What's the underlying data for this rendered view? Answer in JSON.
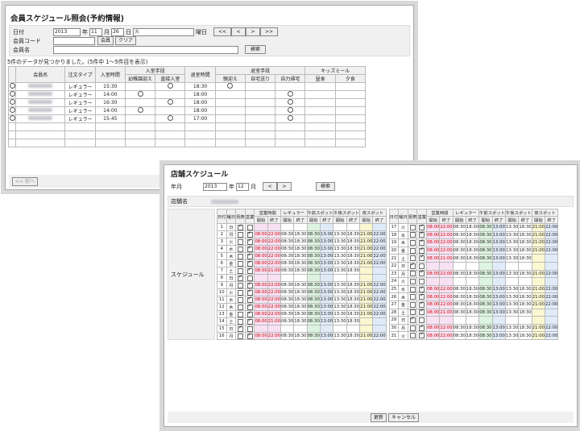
{
  "win1": {
    "title": "会員スケジュール照会(予約情報)",
    "labels": {
      "date": "日付",
      "member_code": "会員コード",
      "member_name": "会員名"
    },
    "date": {
      "year": "2013",
      "year_unit": "年",
      "month": "11",
      "month_unit": "月",
      "day": "26",
      "day_unit": "日",
      "weekday": "火",
      "weekday_label": "曜日"
    },
    "nav": [
      "<<",
      "<",
      ">",
      ">>"
    ],
    "member_button": "会員",
    "clear_button": "クリア",
    "search_button": "検索",
    "result_message": "5件のデータが見つかりました。(5件中 1〜5件目を表示)",
    "headers": {
      "name": "会員名",
      "type": "注文タイプ",
      "entry_time": "入室時間",
      "entry_method": "入室手段",
      "pickup": "幼稚園迎え",
      "direct": "直接入室",
      "exit_time": "退室時間",
      "exit_method": "退室手段",
      "parent": "親迎え",
      "drop": "自宅送り",
      "self": "自力帰宅",
      "kids_meal": "キッズミール",
      "lunch": "昼食",
      "dinner": "夕食"
    },
    "rows": [
      {
        "type": "レギュラー",
        "in": "15:30",
        "pickup": false,
        "direct": true,
        "out": "18:30",
        "parent": true,
        "drop": false,
        "self": false
      },
      {
        "type": "レギュラー",
        "in": "14:00",
        "pickup": true,
        "direct": false,
        "out": "18:00",
        "parent": false,
        "drop": false,
        "self": true
      },
      {
        "type": "レギュラー",
        "in": "16:30",
        "pickup": false,
        "direct": true,
        "out": "18:00",
        "parent": false,
        "drop": false,
        "self": true
      },
      {
        "type": "レギュラー",
        "in": "14:00",
        "pickup": true,
        "direct": false,
        "out": "18:00",
        "parent": false,
        "drop": false,
        "self": true
      },
      {
        "type": "レギュラー",
        "in": "15:45",
        "pickup": false,
        "direct": true,
        "out": "17:00",
        "parent": false,
        "drop": false,
        "self": true
      }
    ],
    "prev_button": "<< 前へ"
  },
  "win2": {
    "title": "店舗スケジュール",
    "year_label": "年月",
    "year": "2013",
    "year_unit": "年",
    "month": "12",
    "month_unit": "月",
    "nav": [
      "<",
      ">"
    ],
    "search_button": "検索",
    "store_label": "店舗名",
    "schedule_label": "スケジュール",
    "headers": {
      "day": "日付",
      "weekday": "曜日",
      "holiday": "祝祭",
      "business": "営業",
      "business_hours": "営業時間",
      "regular": "レギュラー",
      "am_spot": "午前スポット",
      "pm_spot": "午後スポット",
      "night_spot": "夜スポット",
      "start": "開始",
      "end": "終了"
    },
    "left_days": [
      {
        "d": "1",
        "w": "日",
        "h": true,
        "b": false,
        "times": []
      },
      {
        "d": "2",
        "w": "月",
        "h": false,
        "b": true,
        "times": [
          "08:00",
          "22:00",
          "08:30",
          "18:30",
          "08:30",
          "13:00",
          "13:30",
          "18:30",
          "21:00",
          "22:00"
        ]
      },
      {
        "d": "3",
        "w": "火",
        "h": false,
        "b": true,
        "times": [
          "08:00",
          "22:00",
          "08:30",
          "18:30",
          "08:30",
          "13:00",
          "13:30",
          "18:30",
          "21:00",
          "22:00"
        ]
      },
      {
        "d": "4",
        "w": "水",
        "h": false,
        "b": true,
        "times": [
          "08:00",
          "22:00",
          "08:30",
          "18:30",
          "08:30",
          "13:00",
          "13:30",
          "18:30",
          "21:00",
          "22:00"
        ]
      },
      {
        "d": "5",
        "w": "木",
        "h": false,
        "b": true,
        "times": [
          "08:00",
          "22:00",
          "08:30",
          "18:30",
          "08:30",
          "13:00",
          "13:30",
          "18:30",
          "21:00",
          "22:00"
        ]
      },
      {
        "d": "6",
        "w": "金",
        "h": false,
        "b": true,
        "times": [
          "08:00",
          "22:00",
          "08:30",
          "18:30",
          "08:30",
          "13:00",
          "13:30",
          "18:30",
          "21:00",
          "22:00"
        ]
      },
      {
        "d": "7",
        "w": "土",
        "h": false,
        "b": true,
        "times": [
          "08:00",
          "21:00",
          "08:30",
          "18:30",
          "08:30",
          "13:00",
          "13:30",
          "18:30",
          "",
          ""
        ]
      },
      {
        "d": "8",
        "w": "日",
        "h": true,
        "b": false,
        "times": []
      },
      {
        "d": "9",
        "w": "月",
        "h": false,
        "b": true,
        "times": [
          "08:00",
          "22:00",
          "08:30",
          "18:30",
          "08:30",
          "13:00",
          "13:30",
          "18:30",
          "21:00",
          "22:00"
        ]
      },
      {
        "d": "10",
        "w": "火",
        "h": false,
        "b": true,
        "times": [
          "08:00",
          "22:00",
          "08:30",
          "18:30",
          "08:30",
          "13:00",
          "13:30",
          "18:30",
          "21:00",
          "22:00"
        ]
      },
      {
        "d": "11",
        "w": "水",
        "h": false,
        "b": true,
        "times": [
          "08:00",
          "22:00",
          "08:30",
          "18:30",
          "08:30",
          "13:00",
          "13:30",
          "18:30",
          "21:00",
          "22:00"
        ]
      },
      {
        "d": "12",
        "w": "木",
        "h": false,
        "b": true,
        "times": [
          "08:00",
          "22:00",
          "08:30",
          "18:30",
          "08:30",
          "13:00",
          "13:30",
          "18:30",
          "21:00",
          "22:00"
        ]
      },
      {
        "d": "13",
        "w": "金",
        "h": false,
        "b": true,
        "times": [
          "08:00",
          "22:00",
          "08:30",
          "18:30",
          "08:30",
          "13:00",
          "13:30",
          "18:30",
          "21:00",
          "22:00"
        ]
      },
      {
        "d": "14",
        "w": "土",
        "h": false,
        "b": true,
        "times": [
          "08:00",
          "21:00",
          "08:30",
          "18:30",
          "08:30",
          "13:00",
          "13:30",
          "18:30",
          "",
          ""
        ]
      },
      {
        "d": "15",
        "w": "日",
        "h": true,
        "b": false,
        "times": []
      },
      {
        "d": "16",
        "w": "月",
        "h": false,
        "b": true,
        "times": [
          "08:00",
          "22:00",
          "08:30",
          "18:30",
          "08:30",
          "13:00",
          "13:30",
          "18:30",
          "21:00",
          "22:00"
        ]
      }
    ],
    "right_days": [
      {
        "d": "17",
        "w": "火",
        "h": false,
        "b": true,
        "times": [
          "08:00",
          "22:00",
          "08:30",
          "18:30",
          "08:30",
          "13:00",
          "13:30",
          "18:30",
          "21:00",
          "22:00"
        ]
      },
      {
        "d": "18",
        "w": "水",
        "h": false,
        "b": true,
        "times": [
          "08:00",
          "22:00",
          "08:30",
          "18:30",
          "08:30",
          "13:00",
          "13:30",
          "18:30",
          "21:00",
          "22:00"
        ]
      },
      {
        "d": "19",
        "w": "木",
        "h": false,
        "b": true,
        "times": [
          "08:00",
          "22:00",
          "08:30",
          "18:30",
          "08:30",
          "13:00",
          "13:30",
          "18:30",
          "21:00",
          "22:00"
        ]
      },
      {
        "d": "20",
        "w": "金",
        "h": false,
        "b": true,
        "times": [
          "08:00",
          "22:00",
          "08:30",
          "18:30",
          "08:30",
          "13:00",
          "13:30",
          "18:30",
          "21:00",
          "22:00"
        ]
      },
      {
        "d": "21",
        "w": "土",
        "h": false,
        "b": true,
        "times": [
          "08:00",
          "21:00",
          "08:30",
          "18:30",
          "08:30",
          "13:00",
          "13:30",
          "18:30",
          "",
          ""
        ]
      },
      {
        "d": "22",
        "w": "日",
        "h": true,
        "b": false,
        "times": []
      },
      {
        "d": "23",
        "w": "月",
        "h": false,
        "b": true,
        "times": [
          "08:00",
          "22:00",
          "08:30",
          "18:30",
          "08:30",
          "13:00",
          "13:30",
          "18:30",
          "21:00",
          "22:00"
        ]
      },
      {
        "d": "24",
        "w": "火",
        "h": false,
        "b": false,
        "times": []
      },
      {
        "d": "25",
        "w": "水",
        "h": false,
        "b": true,
        "times": [
          "08:00",
          "22:00",
          "08:30",
          "18:30",
          "08:30",
          "13:00",
          "13:30",
          "18:30",
          "21:00",
          "22:00"
        ]
      },
      {
        "d": "26",
        "w": "木",
        "h": false,
        "b": true,
        "times": [
          "08:00",
          "22:00",
          "08:30",
          "18:30",
          "08:30",
          "13:00",
          "13:30",
          "18:30",
          "21:00",
          "22:00"
        ]
      },
      {
        "d": "27",
        "w": "金",
        "h": false,
        "b": true,
        "times": [
          "08:00",
          "22:00",
          "08:30",
          "18:30",
          "08:30",
          "13:00",
          "13:30",
          "18:30",
          "21:00",
          "22:00"
        ]
      },
      {
        "d": "28",
        "w": "土",
        "h": false,
        "b": true,
        "times": [
          "08:00",
          "21:00",
          "08:30",
          "18:30",
          "08:30",
          "13:00",
          "13:30",
          "18:30",
          "",
          ""
        ]
      },
      {
        "d": "29",
        "w": "日",
        "h": true,
        "b": false,
        "times": []
      },
      {
        "d": "30",
        "w": "月",
        "h": false,
        "b": true,
        "times": [
          "08:00",
          "22:00",
          "08:30",
          "18:30",
          "08:30",
          "13:00",
          "13:30",
          "18:30",
          "21:00",
          "22:00"
        ]
      },
      {
        "d": "31",
        "w": "火",
        "h": false,
        "b": true,
        "times": [
          "08:00",
          "22:00",
          "08:30",
          "18:30",
          "08:30",
          "13:00",
          "13:30",
          "18:30",
          "21:00",
          "22:00"
        ]
      }
    ],
    "update_button": "更新",
    "cancel_button": "キャンセル"
  }
}
